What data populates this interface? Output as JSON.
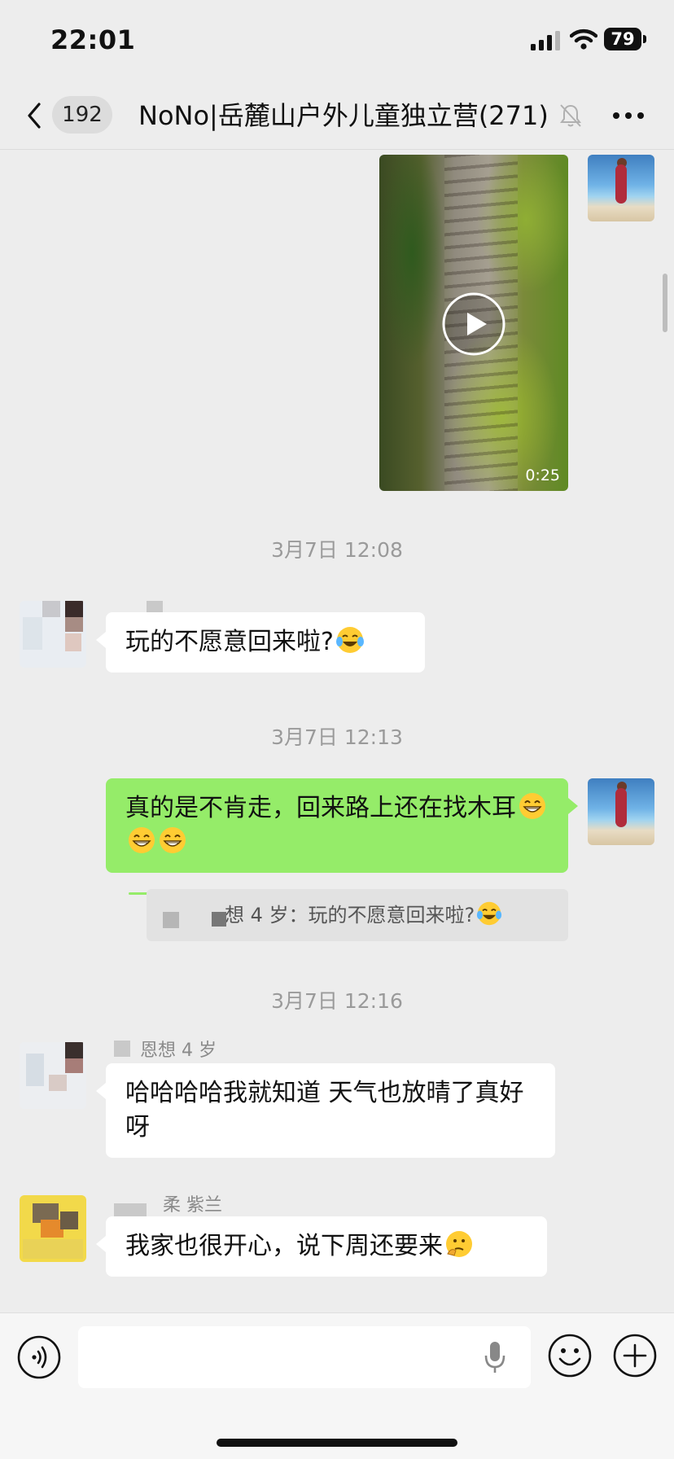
{
  "status_bar": {
    "time": "22:01",
    "battery": "79"
  },
  "header": {
    "unread_count": "192",
    "title": "NoNo|岳麓山户外儿童独立营(271)"
  },
  "messages": {
    "video": {
      "duration": "0:25"
    },
    "time_1": "3月7日 12:08",
    "msg_1": {
      "text": "玩的不愿意回来啦?"
    },
    "time_2": "3月7日 12:13",
    "msg_2": {
      "text": "真的是不肯走，回来路上还在找木耳"
    },
    "quote": {
      "text": "想 4 岁：玩的不愿意回来啦?"
    },
    "time_3": "3月7日 12:16",
    "msg_3": {
      "sender": "恩想 4 岁",
      "text": "哈哈哈哈我就知道 天气也放晴了真好呀"
    },
    "msg_4": {
      "sender": "柔 紫兰",
      "text": "我家也很开心，说下周还要来"
    }
  },
  "colors": {
    "background": "#ededed",
    "outgoing_bubble": "#95ec69",
    "incoming_bubble": "#ffffff"
  },
  "icons": [
    "back-icon",
    "mute-icon",
    "more-icon",
    "play-icon",
    "laugh-cry-emoji",
    "grin-emoji",
    "thinking-emoji",
    "voice-icon",
    "mic-icon",
    "smiley-icon",
    "plus-icon"
  ]
}
